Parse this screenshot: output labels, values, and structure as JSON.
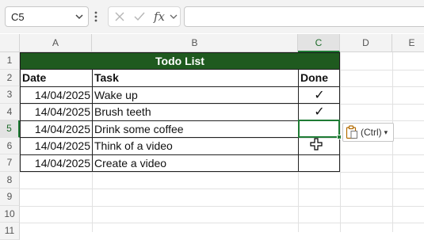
{
  "formula_bar": {
    "name_box": "C5",
    "fx_label": "fx",
    "formula_value": ""
  },
  "columns": [
    "A",
    "B",
    "C",
    "D",
    "E"
  ],
  "rows": [
    "1",
    "2",
    "3",
    "4",
    "5",
    "6",
    "7",
    "8",
    "9",
    "10",
    "11"
  ],
  "sheet": {
    "title": "Todo List",
    "headers": {
      "date": "Date",
      "task": "Task",
      "done": "Done"
    },
    "tasks": [
      {
        "date": "14/04/2025",
        "task": "Wake up",
        "done": "✓"
      },
      {
        "date": "14/04/2025",
        "task": "Brush teeth",
        "done": "✓"
      },
      {
        "date": "14/04/2025",
        "task": "Drink some coffee",
        "done": ""
      },
      {
        "date": "14/04/2025",
        "task": "Think of a video",
        "done": ""
      },
      {
        "date": "14/04/2025",
        "task": "Create a video",
        "done": ""
      }
    ]
  },
  "paste_options": {
    "label": "(Ctrl)",
    "dropdown": "▾"
  },
  "selection": {
    "cell": "C5",
    "accent": "#1e7b34"
  },
  "colors": {
    "title_fill": "#1f5a1f",
    "title_text": "#ffffff"
  }
}
